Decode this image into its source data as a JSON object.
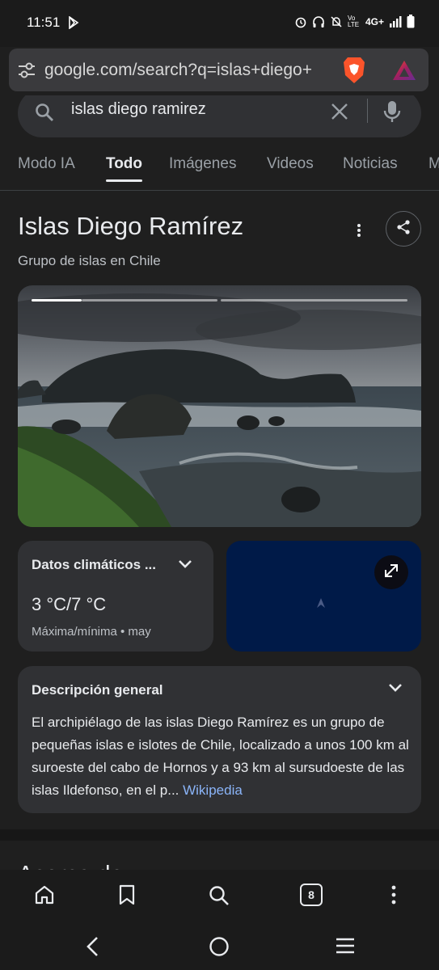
{
  "status_bar": {
    "time": "11:51",
    "network": "4G+",
    "volte": "Vo LTE"
  },
  "browser": {
    "url": "google.com/search?q=islas+diego+",
    "tab_count": "8"
  },
  "search": {
    "query": "islas diego ramirez"
  },
  "tabs": [
    {
      "label": "Modo IA"
    },
    {
      "label": "Todo"
    },
    {
      "label": "Imágenes"
    },
    {
      "label": "Videos"
    },
    {
      "label": "Noticias"
    },
    {
      "label": "M"
    }
  ],
  "knowledge_panel": {
    "title": "Islas Diego Ramírez",
    "subtitle": "Grupo de islas en Chile",
    "weather": {
      "title": "Datos climáticos ...",
      "temperature": "3 °C/7 °C",
      "subtitle": "Máxima/mínima • may"
    },
    "description": {
      "title": "Descripción general",
      "text": "El archipiélago de las islas Diego Ramírez es un grupo de pequeñas islas e islotes de Chile, localizado a unos 100 km al suroeste del cabo de Hornos y a 93 km al sursudoeste de las islas Ildefonso, en el p... ",
      "source": "Wikipedia"
    },
    "next_section_title": "Acerca de"
  },
  "colors": {
    "background": "#1f1f1f",
    "card": "#303134",
    "link": "#8ab4f8",
    "map": "#001a48"
  }
}
